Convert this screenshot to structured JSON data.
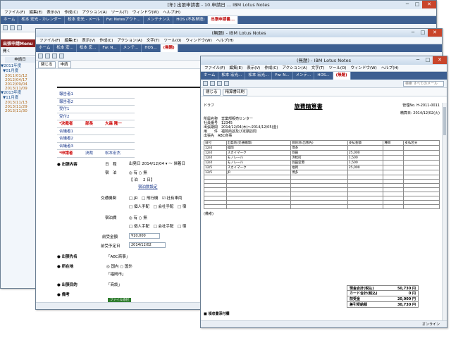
{
  "back": {
    "title": "[年] 出張申請書 - 10.申請日 ... IBM Lotus Notes",
    "menu": [
      "ファイル(F)",
      "編集(E)",
      "表示(V)",
      "作成(C)",
      "アクション(A)",
      "ツール(T)",
      "ウィンドウ(W)",
      "ヘルプ(H)"
    ],
    "tabs": [
      "ホーム",
      "松本 宏光 - カレンダー",
      "松本 宏光 - メール",
      "Fw: Notesアウト...",
      "メンテナンス",
      "HOS (不各単語)",
      "出張申請書..."
    ],
    "sidebar_title": "出張申請Menu",
    "open_btn": "開く",
    "cal_header": "申請日",
    "years": [
      "▼2011年度",
      "▼2013年度"
    ],
    "months": [
      "▼01月度",
      "▼11月度"
    ],
    "days": [
      "2011/01/12",
      "2012/04/17",
      "2012/09/04",
      "2013/11/09",
      "2013/11/13",
      "2013/11/29",
      "2013/11/30"
    ]
  },
  "mid": {
    "title": "(無題) - IBM Lotus Notes",
    "menu": [
      "ファイル(F)",
      "編集(E)",
      "表示(V)",
      "作成(C)",
      "アクション(A)",
      "文字(T)",
      "ツール(O)",
      "ウィンドウ(W)",
      "ヘルプ(H)"
    ],
    "tabs": [
      "ホーム",
      "松本 宏...",
      "松本 宏...",
      "Fw: N...",
      "メンテ...",
      "HOS...",
      "(無題)"
    ],
    "actions": [
      "閉じる",
      "申請"
    ],
    "form_title": "出張申請書",
    "grid": [
      {
        "k": "報告者1",
        "v": ""
      },
      {
        "k": "報告者2",
        "v": ""
      },
      {
        "k": "受付1",
        "v": ""
      },
      {
        "k": "受付2",
        "v": ""
      },
      {
        "k": "*決裁者",
        "v": "部長",
        "v2": "大森 隆一"
      },
      {
        "k": "合議者1",
        "v": ""
      },
      {
        "k": "合議者2",
        "v": ""
      },
      {
        "k": "合議者3",
        "v": ""
      },
      {
        "k": "*申請者",
        "v": "決裁",
        "v2": "松本宏杰"
      }
    ],
    "sections": [
      "● 出張内容",
      "● 出張先名",
      "● 所在地",
      "● 出張目的",
      "● 備考"
    ],
    "labels": {
      "date": "日　程",
      "stay": "宿　泊",
      "transport": "交通機関",
      "expense": "宿泊費",
      "advance": "前受金額",
      "advance_date": "前受予定日"
    },
    "date_val": "出発日 2014/12/04",
    "date_to": "～ 帰着日",
    "stay_opts": "◎ 有 ○ 無",
    "stay_cnt": "【 泊　 2 日】",
    "stay_btn": "宿泊数設定",
    "transport_opts": "□ JR　□ 飛行機　☑ 社有車両",
    "transport_opts2": "□ 個人手配　□ 会社手配　□ 宿",
    "expense_opts": "◎ 有 ○ 無",
    "expense_opts2": "□ 個人手配　□ 会社手配　□ 宿",
    "advance_val": "¥10,000",
    "advance_date_val": "2014/12/02",
    "dest": "「ABC商事」",
    "loc": "◎ 国内 ○ 国外",
    "loc2": "「福岡市」",
    "purpose": "「商談」",
    "note_btn": "ファイル添付"
  },
  "front": {
    "title": "(無題) - IBM Lotus Notes",
    "menu": [
      "ファイル(F)",
      "編集(E)",
      "表示(V)",
      "作成(C)",
      "アクション(A)",
      "文字(T)",
      "ツール(O)",
      "ウィンドウ(W)",
      "ヘルプ(H)"
    ],
    "tabs": [
      "ホーム",
      "松本 宏光...",
      "松本 宏光...",
      "Fw: N...",
      "メンテ...",
      "HOS...",
      "(無題)"
    ],
    "actions": [
      "閉じる",
      "精算書印刷"
    ],
    "search_placeholder": "検索 すべてのメール",
    "doc_title": "旅費精算書",
    "no_label": "管理No. H-2011-0011",
    "date_label": "精算日: 2014/12/02(火)",
    "info": [
      "所属名称　営業部販売センター",
      "社員番号　12345",
      "出張期間　2014/12/04(木)～2014/12/05(金)",
      "用　　件　福岡商談及び定期訪問",
      "出張先　ABC商事"
    ],
    "cols": [
      "日付",
      "出発地(交通機関)",
      "目的地(出張先)",
      "支払金額",
      "種目",
      "支払区分"
    ],
    "rows": [
      [
        "12",
        "4",
        "福岡",
        "JR",
        "博多",
        "",
        ""
      ],
      [
        "12",
        "4",
        "スカイマーク",
        "",
        "羽田",
        "25,000",
        ""
      ],
      [
        "12",
        "4",
        "モノレール",
        "",
        "浜松町",
        "1,500",
        ""
      ],
      [
        "12",
        "4",
        "モノレール",
        "",
        "羽田空港",
        "1,500",
        ""
      ],
      [
        "12",
        "5",
        "スカイマーク",
        "",
        "福岡",
        "25,000",
        ""
      ],
      [
        "12",
        "5",
        "JR",
        "",
        "博多",
        "",
        ""
      ]
    ],
    "totals": [
      {
        "l": "現金合計(税込)",
        "v": "50,730 円"
      },
      {
        "l": "カード合計(税込)",
        "v": "0 円"
      },
      {
        "l": "前受金",
        "v": "20,000 円"
      },
      {
        "l": "差引受給額",
        "v": "30,730 円"
      }
    ],
    "remarks": "(備考)",
    "attach": "■ 領収書添付欄",
    "status": "オンライン"
  }
}
